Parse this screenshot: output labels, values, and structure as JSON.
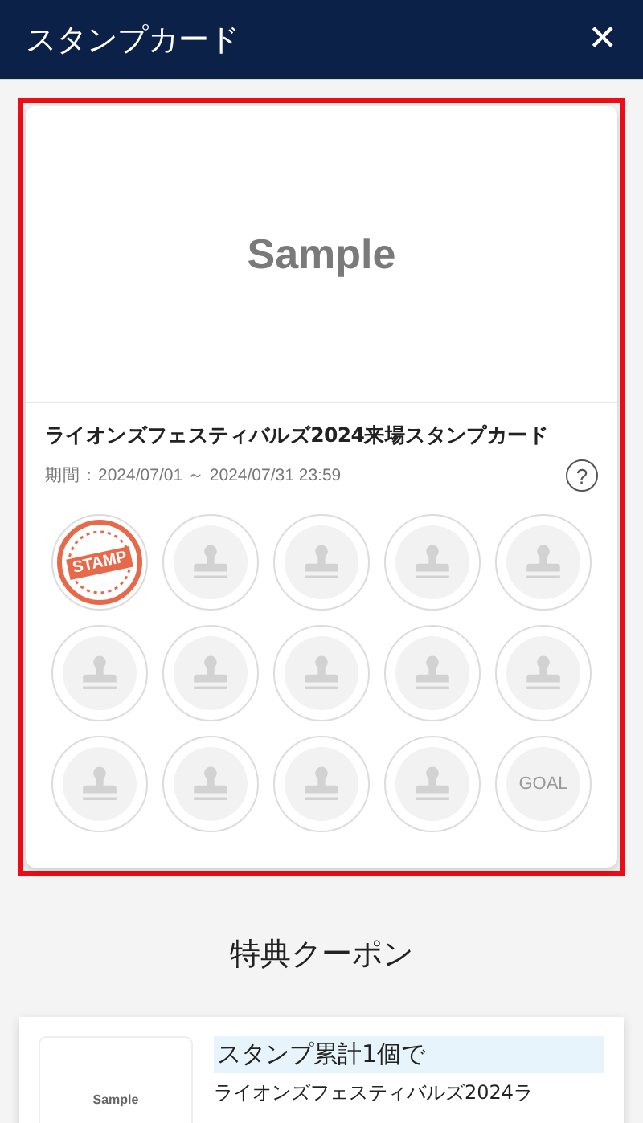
{
  "header": {
    "title": "スタンプカード",
    "close": "✕"
  },
  "card": {
    "highlighted": true,
    "image": {
      "kind": "placeholder",
      "label": "Sample"
    },
    "title": "ライオンズフェスティバルズ2024来場スタンプカード",
    "period": "期間：2024/07/01 ～ 2024/07/31 23:59",
    "help": "?",
    "stamps": [
      {
        "kind": "stamped",
        "label": "STAMP"
      },
      {
        "kind": "empty"
      },
      {
        "kind": "empty"
      },
      {
        "kind": "empty"
      },
      {
        "kind": "empty"
      },
      {
        "kind": "empty"
      },
      {
        "kind": "empty"
      },
      {
        "kind": "empty"
      },
      {
        "kind": "empty"
      },
      {
        "kind": "empty"
      },
      {
        "kind": "empty"
      },
      {
        "kind": "empty"
      },
      {
        "kind": "empty"
      },
      {
        "kind": "empty"
      },
      {
        "kind": "goal",
        "label": "GOAL"
      }
    ]
  },
  "coupons_heading": "特典クーポン",
  "coupons": [
    {
      "thumbnail": "Sample",
      "title": "スタンプ累計1個で",
      "description": "ライオンズフェスティバルズ2024ラ"
    }
  ]
}
